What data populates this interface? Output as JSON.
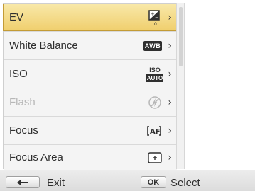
{
  "menu": {
    "items": [
      {
        "label": "EV",
        "icon": "ev-icon",
        "value": "0"
      },
      {
        "label": "White Balance",
        "icon": "awb-icon",
        "value": "AWB"
      },
      {
        "label": "ISO",
        "icon": "iso-auto-icon",
        "value_top": "ISO",
        "value_bottom": "AUTO"
      },
      {
        "label": "Flash",
        "icon": "flash-off-icon"
      },
      {
        "label": "Focus",
        "icon": "af-icon",
        "value": "AF"
      },
      {
        "label": "Focus Area",
        "icon": "center-af-icon"
      }
    ]
  },
  "bottom_bar": {
    "back_label": "Exit",
    "ok_key": "OK",
    "ok_label": "Select"
  },
  "colors": {
    "selected_fill": "#f0cf6e",
    "disabled_text": "#b7b7b7"
  }
}
